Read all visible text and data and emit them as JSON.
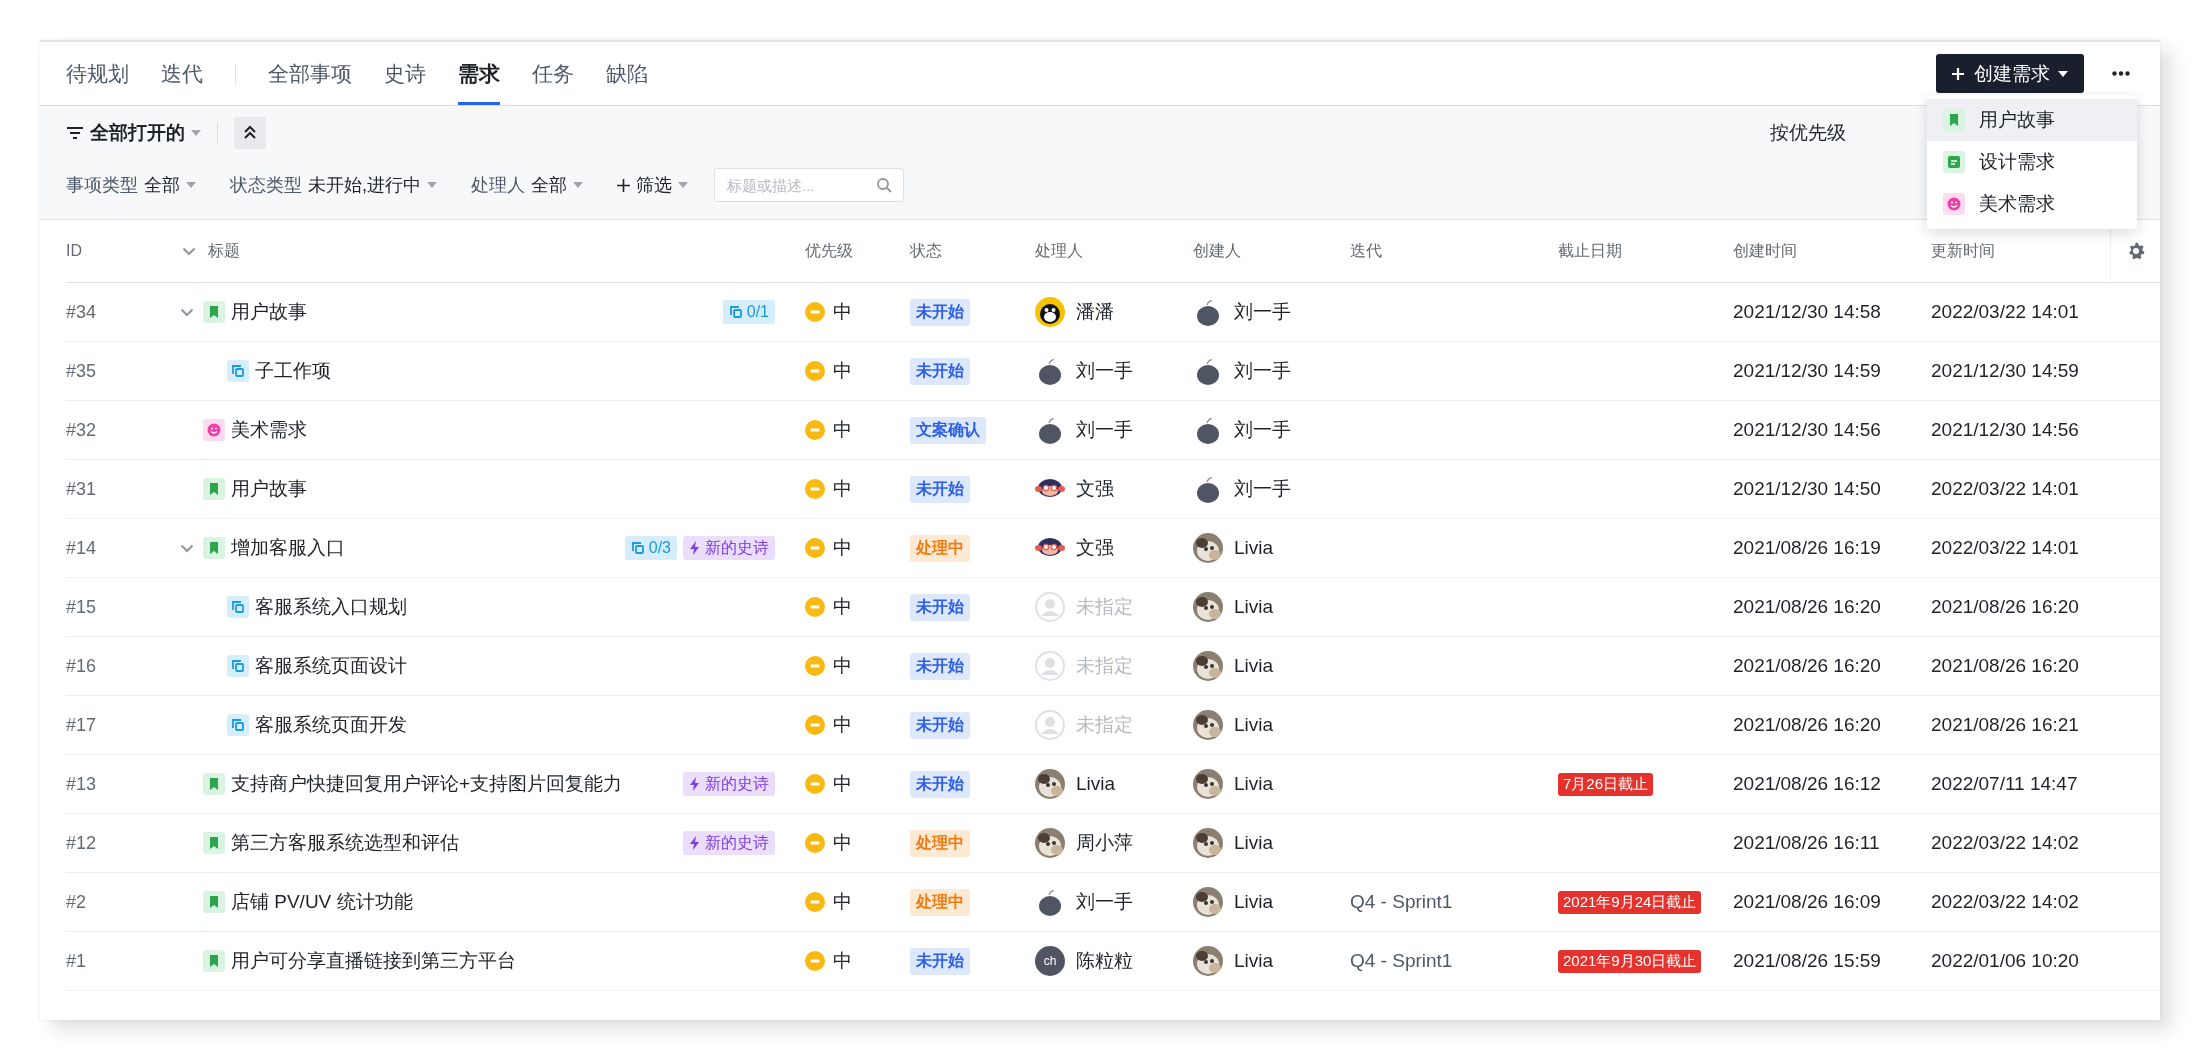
{
  "top_bar": {
    "tab_groups": [
      {
        "tabs": [
          {
            "label": "待规划",
            "selected": false
          },
          {
            "label": "迭代",
            "selected": false
          }
        ]
      },
      {
        "tabs": [
          {
            "label": "全部事项",
            "selected": false
          },
          {
            "label": "史诗",
            "selected": false
          },
          {
            "label": "需求",
            "selected": true
          },
          {
            "label": "任务",
            "selected": false
          },
          {
            "label": "缺陷",
            "selected": false
          }
        ]
      }
    ],
    "create_button": {
      "label": "创建需求"
    }
  },
  "create_menu": {
    "items": [
      {
        "label": "用户故事",
        "kind": "story",
        "selected": true
      },
      {
        "label": "设计需求",
        "kind": "design",
        "selected": false
      },
      {
        "label": "美术需求",
        "kind": "art",
        "selected": false
      }
    ]
  },
  "toolbar": {
    "view": "全部打开的",
    "sort": "按优先级",
    "filters": [
      {
        "label": "事项类型",
        "value": "全部"
      },
      {
        "label": "状态类型",
        "value": "未开始,进行中"
      },
      {
        "label": "处理人",
        "value": "全部"
      }
    ],
    "add_filter": "筛选",
    "search": {
      "placeholder": "标题或描述..."
    }
  },
  "table": {
    "columns": [
      "ID",
      "标题",
      "优先级",
      "状态",
      "处理人",
      "创建人",
      "迭代",
      "截止日期",
      "创建时间",
      "更新时间"
    ],
    "rows": [
      {
        "id": "#34",
        "kind": "story",
        "title": "用户故事",
        "expanded": true,
        "badges": [
          {
            "kind": "subtasks",
            "text": "0/1"
          }
        ],
        "priority": "中",
        "status": {
          "text": "未开始",
          "kind": "todo"
        },
        "assignee": {
          "name": "潘潘",
          "kind": "penguin"
        },
        "creator": {
          "name": "刘一手",
          "kind": "bomb"
        },
        "created": "2021/12/30 14:58",
        "updated": "2022/03/22 14:01",
        "children": [
          {
            "id": "#35",
            "kind": "subtask",
            "title": "子工作项",
            "priority": "中",
            "status": {
              "text": "未开始",
              "kind": "todo"
            },
            "assignee": {
              "name": "刘一手",
              "kind": "bomb"
            },
            "creator": {
              "name": "刘一手",
              "kind": "bomb"
            },
            "created": "2021/12/30 14:59",
            "updated": "2021/12/30 14:59"
          }
        ]
      },
      {
        "id": "#32",
        "kind": "art",
        "title": "美术需求",
        "priority": "中",
        "status": {
          "text": "文案确认",
          "kind": "todo"
        },
        "assignee": {
          "name": "刘一手",
          "kind": "bomb"
        },
        "creator": {
          "name": "刘一手",
          "kind": "bomb"
        },
        "created": "2021/12/30 14:56",
        "updated": "2021/12/30 14:56"
      },
      {
        "id": "#31",
        "kind": "story",
        "title": "用户故事",
        "priority": "中",
        "status": {
          "text": "未开始",
          "kind": "todo"
        },
        "assignee": {
          "name": "文强",
          "kind": "monkey"
        },
        "creator": {
          "name": "刘一手",
          "kind": "bomb"
        },
        "created": "2021/12/30 14:50",
        "updated": "2022/03/22 14:01"
      },
      {
        "id": "#14",
        "kind": "story",
        "title": "增加客服入口",
        "expanded": true,
        "badges": [
          {
            "kind": "subtasks",
            "text": "0/3"
          },
          {
            "kind": "epic",
            "text": "新的史诗"
          }
        ],
        "priority": "中",
        "status": {
          "text": "处理中",
          "kind": "doing"
        },
        "assignee": {
          "name": "文强",
          "kind": "monkey"
        },
        "creator": {
          "name": "Livia"
        },
        "created": "2021/08/26 16:19",
        "updated": "2022/03/22 14:01",
        "children": [
          {
            "id": "#15",
            "kind": "subtask",
            "title": "客服系统入口规划",
            "priority": "中",
            "status": {
              "text": "未开始",
              "kind": "todo"
            },
            "assignee": {
              "name": "未指定",
              "kind": "none"
            },
            "creator": {
              "name": "Livia"
            },
            "created": "2021/08/26 16:20",
            "updated": "2021/08/26 16:20"
          },
          {
            "id": "#16",
            "kind": "subtask",
            "title": "客服系统页面设计",
            "priority": "中",
            "status": {
              "text": "未开始",
              "kind": "todo"
            },
            "assignee": {
              "name": "未指定",
              "kind": "none"
            },
            "creator": {
              "name": "Livia"
            },
            "created": "2021/08/26 16:20",
            "updated": "2021/08/26 16:20"
          },
          {
            "id": "#17",
            "kind": "subtask",
            "title": "客服系统页面开发",
            "priority": "中",
            "status": {
              "text": "未开始",
              "kind": "todo"
            },
            "assignee": {
              "name": "未指定",
              "kind": "none"
            },
            "creator": {
              "name": "Livia"
            },
            "created": "2021/08/26 16:20",
            "updated": "2021/08/26 16:21"
          }
        ]
      },
      {
        "id": "#13",
        "kind": "story",
        "title": "支持商户快捷回复用户评论+支持图片回复能力",
        "badges": [
          {
            "kind": "epic",
            "text": "新的史诗"
          }
        ],
        "priority": "中",
        "status": {
          "text": "未开始",
          "kind": "todo"
        },
        "assignee": {
          "name": "Livia"
        },
        "creator": {
          "name": "Livia"
        },
        "deadline": "7月26日截止",
        "created": "2021/08/26 16:12",
        "updated": "2022/07/11 14:47"
      },
      {
        "id": "#12",
        "kind": "story",
        "title": "第三方客服系统选型和评估",
        "badges": [
          {
            "kind": "epic",
            "text": "新的史诗"
          }
        ],
        "priority": "中",
        "status": {
          "text": "处理中",
          "kind": "doing"
        },
        "assignee": {
          "name": "周小萍"
        },
        "creator": {
          "name": "Livia"
        },
        "created": "2021/08/26 16:11",
        "updated": "2022/03/22 14:02"
      },
      {
        "id": "#2",
        "kind": "story",
        "title": "店铺 PV/UV 统计功能",
        "priority": "中",
        "status": {
          "text": "处理中",
          "kind": "doing"
        },
        "assignee": {
          "name": "刘一手",
          "kind": "bomb"
        },
        "creator": {
          "name": "Livia"
        },
        "iteration": "Q4 - Sprint1",
        "deadline": "2021年9月24日截止",
        "created": "2021/08/26 16:09",
        "updated": "2022/03/22 14:02"
      },
      {
        "id": "#1",
        "kind": "story",
        "title": "用户可分享直播链接到第三方平台",
        "priority": "中",
        "status": {
          "text": "未开始",
          "kind": "todo"
        },
        "assignee": {
          "name": "陈粒粒",
          "kind": "initials",
          "initials": "ch"
        },
        "creator": {
          "name": "Livia"
        },
        "iteration": "Q4 - Sprint1",
        "deadline": "2021年9月30日截止",
        "created": "2021/08/26 15:59",
        "updated": "2022/01/06 10:20"
      }
    ]
  }
}
